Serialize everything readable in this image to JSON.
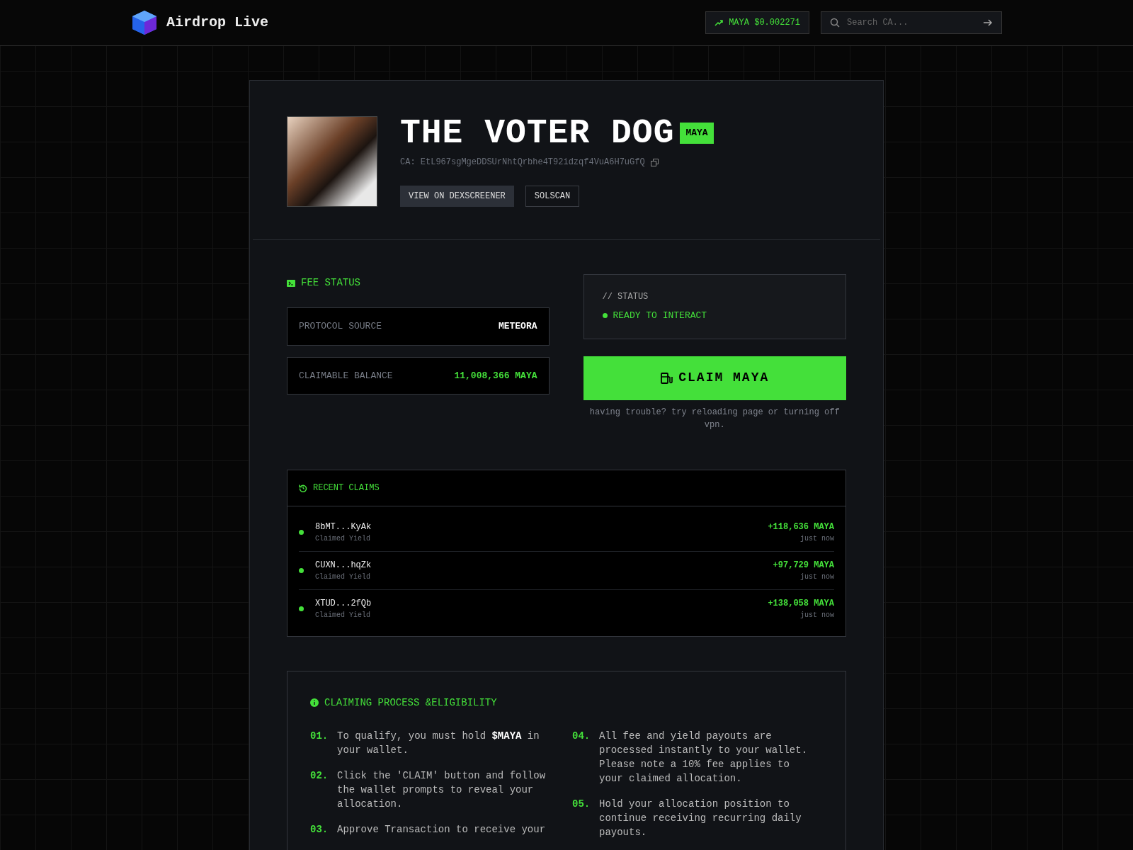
{
  "navbar": {
    "brand": "Airdrop Live",
    "price_ticker": "MAYA $0.002271",
    "search": {
      "placeholder": "Search CA..."
    }
  },
  "token": {
    "name": "THE VOTER DOG",
    "symbol": "MAYA",
    "contract": "CA: EtL967sgMgeDDSUrNhtQrbhe4T92idzqf4VuA6H7uGfQ",
    "links": [
      "VIEW ON DEXSCREENER",
      "SOLSCAN"
    ]
  },
  "fee_status": {
    "title": "FEE STATUS",
    "rows": [
      {
        "label": "PROTOCOL SOURCE",
        "value": "METEORA",
        "kind": "plain"
      },
      {
        "label": "CLAIMABLE BALANCE",
        "value": "11,008,366 MAYA",
        "kind": "highlight"
      }
    ]
  },
  "status": {
    "heading": "// STATUS",
    "value": "READY TO INTERACT",
    "button": "CLAIM MAYA",
    "note": "having trouble? try reloading page or turning off vpn."
  },
  "recent_claims": {
    "title": "RECENT CLAIMS",
    "rows": [
      {
        "wallet": "8bMT...KyAk",
        "action": "Claimed Yield",
        "amount": "+118,636 MAYA",
        "time": "just now"
      },
      {
        "wallet": "CUXN...hqZk",
        "action": "Claimed Yield",
        "amount": "+97,729 MAYA",
        "time": "just now"
      },
      {
        "wallet": "XTUD...2fQb",
        "action": "Claimed Yield",
        "amount": "+138,058 MAYA",
        "time": "just now"
      }
    ]
  },
  "process": {
    "title": "CLAIMING PROCESS &ELIGIBILITY",
    "steps": [
      {
        "number": "01.",
        "text": "To qualify, you must hold **$MAYA** in your wallet."
      },
      {
        "number": "02.",
        "text": "Click the 'CLAIM' button and follow the wallet prompts to reveal your allocation."
      },
      {
        "number": "03.",
        "text": "Approve Transaction to receive your"
      },
      {
        "number": "04.",
        "text": "All fee and yield payouts are processed instantly to your wallet. Please note a 10% fee applies to your claimed allocation."
      },
      {
        "number": "05.",
        "text": "Hold your allocation position to continue receiving recurring daily payouts."
      }
    ]
  }
}
